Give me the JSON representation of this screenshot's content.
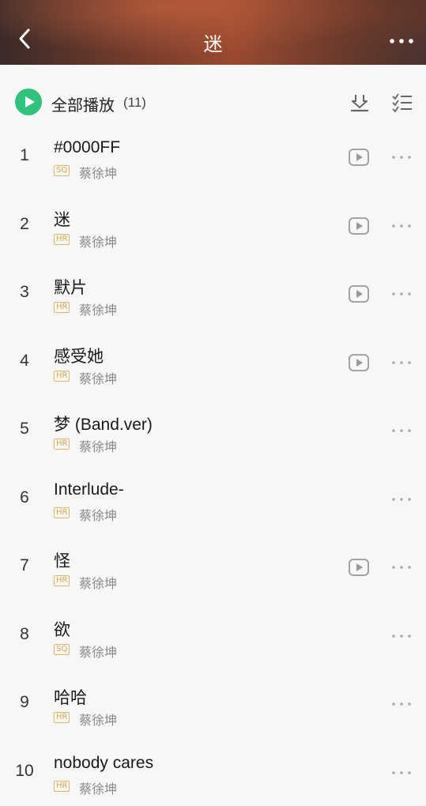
{
  "header": {
    "title": "迷",
    "back_icon": "chevron-left-icon",
    "more_icon": "more-horizontal-icon"
  },
  "toolbar": {
    "play_all_label": "全部播放",
    "play_all_count": "(11)",
    "play_icon": "play-circle-icon",
    "download_icon": "download-icon",
    "multiselect_icon": "checklist-icon"
  },
  "colors": {
    "accent_green": "#31c27c",
    "badge_gold": "#d9a54e",
    "text_secondary": "#8a8a8a"
  },
  "songs": [
    {
      "index": "1",
      "title": "#0000FF",
      "badge": "SQ",
      "artist": "蔡徐坤",
      "has_mv": true
    },
    {
      "index": "2",
      "title": "迷",
      "badge": "HR",
      "artist": "蔡徐坤",
      "has_mv": true
    },
    {
      "index": "3",
      "title": "默片",
      "badge": "HR",
      "artist": "蔡徐坤",
      "has_mv": true
    },
    {
      "index": "4",
      "title": "感受她",
      "badge": "HR",
      "artist": "蔡徐坤",
      "has_mv": true
    },
    {
      "index": "5",
      "title": "梦 (Band.ver)",
      "badge": "HR",
      "artist": "蔡徐坤",
      "has_mv": false
    },
    {
      "index": "6",
      "title": "Interlude-",
      "badge": "HR",
      "artist": "蔡徐坤",
      "has_mv": false
    },
    {
      "index": "7",
      "title": "怪",
      "badge": "HR",
      "artist": "蔡徐坤",
      "has_mv": true
    },
    {
      "index": "8",
      "title": "欲",
      "badge": "SQ",
      "artist": "蔡徐坤",
      "has_mv": false
    },
    {
      "index": "9",
      "title": "哈哈",
      "badge": "HR",
      "artist": "蔡徐坤",
      "has_mv": false
    },
    {
      "index": "10",
      "title": "nobody cares",
      "badge": "HR",
      "artist": "蔡徐坤",
      "has_mv": false
    }
  ]
}
